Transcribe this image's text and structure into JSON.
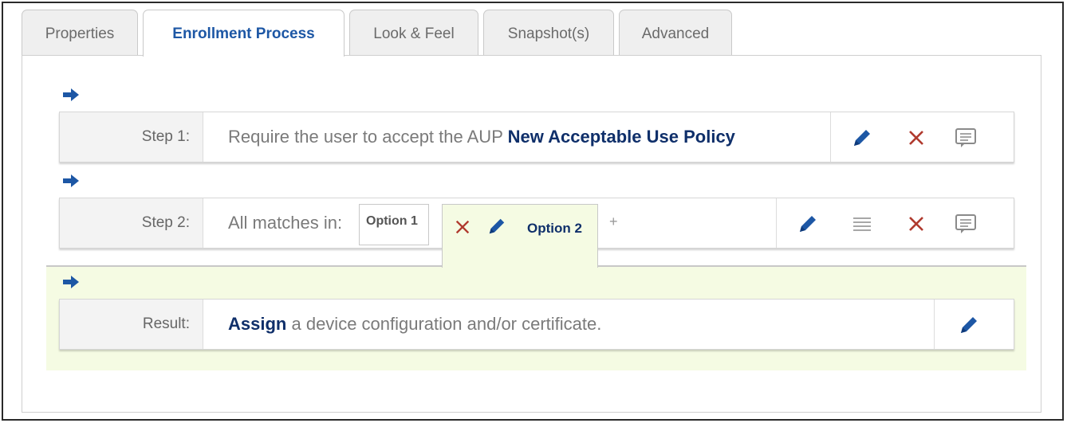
{
  "tabs": [
    {
      "label": "Properties",
      "active": false
    },
    {
      "label": "Enrollment Process",
      "active": true
    },
    {
      "label": "Look & Feel",
      "active": false
    },
    {
      "label": "Snapshot(s)",
      "active": false
    },
    {
      "label": "Advanced",
      "active": false
    }
  ],
  "step1": {
    "label": "Step 1:",
    "text": "Require the user to accept the AUP",
    "policy": "New Acceptable Use Policy"
  },
  "step2": {
    "label": "Step 2:",
    "text": "All matches in:",
    "option1": "Option 1",
    "option2": "Option 2",
    "add": "+"
  },
  "result": {
    "label": "Result:",
    "action": "Assign",
    "text": "a device configuration and/or certificate."
  },
  "colors": {
    "accent": "#1d57a5",
    "delete": "#b03a2e",
    "highlight": "#f5fbe3"
  },
  "icons": [
    "arrow-right-icon",
    "pencil-icon",
    "close-icon",
    "comment-icon",
    "reorder-icon",
    "plus-icon"
  ]
}
